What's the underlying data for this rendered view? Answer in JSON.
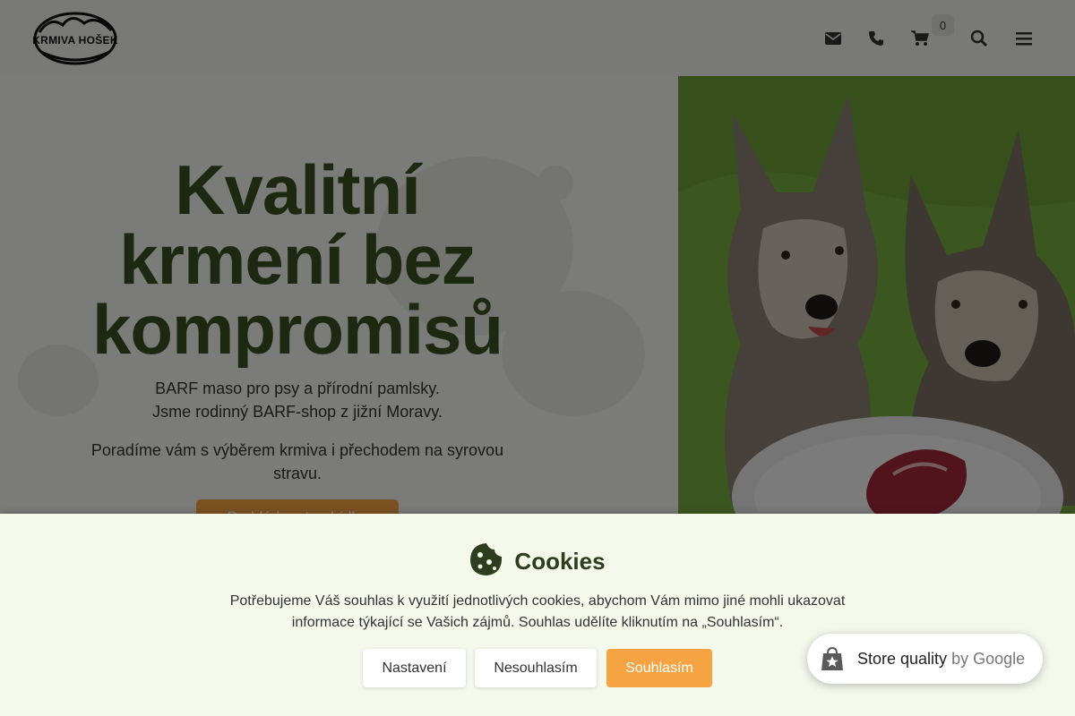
{
  "header": {
    "logo_text": "KRMIVA HOŠEK",
    "icons": [
      "envelope-icon",
      "phone-icon",
      "cart-icon",
      "search-icon",
      "menu-icon"
    ],
    "cart_count": "0"
  },
  "hero": {
    "title": "Kvalitní krmení bez kompromisů",
    "subtitle_line1": "BARF maso pro psy a přírodní pamlsky.",
    "subtitle_line2": "Jsme rodinný BARF-shop z jižní Moravy.",
    "subtitle2": "Poradíme vám s výběrem krmiva i přechodem na syrovou stravu.",
    "button_label": "Prohlédnout nabídku"
  },
  "cookies": {
    "title": "Cookies",
    "text": "Potřebujeme Váš souhlas k využití jednotlivých cookies, abychom Vám mimo jiné mohli ukazovat informace týkající se Vašich zájmů. Souhlas udělíte kliknutím na „Souhlasím“.",
    "settings_label": "Nastavení",
    "decline_label": "Nesouhlasím",
    "accept_label": "Souhlasím"
  },
  "google_badge": {
    "label": "Store quality",
    "by": "by Google"
  },
  "colors": {
    "accent_orange": "#f6a343",
    "title_green": "#3b5020",
    "cookie_bg": "#f5f9ec"
  }
}
